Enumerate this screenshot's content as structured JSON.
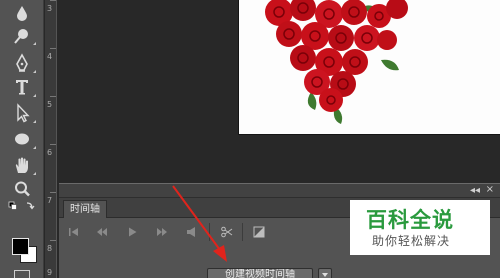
{
  "ruler": {
    "labels": [
      "3",
      "4",
      "5",
      "6",
      "7",
      "8",
      "9"
    ]
  },
  "timeline_panel": {
    "tab_label": "时间轴",
    "create_button_label": "创建视频时间轴",
    "collapse_symbol": "◂◂",
    "close_symbol": "×"
  },
  "toolbar": {
    "tools": [
      "blur-icon",
      "dodge-icon",
      "pen-icon",
      "type-icon",
      "path-selection-icon",
      "ellipse-icon",
      "hand-icon",
      "zoom-icon",
      "swap-colors-icon",
      "foreground-background-colors"
    ]
  },
  "watermark": {
    "title": "百科全说",
    "subtitle": "助你轻松解决"
  },
  "colors": {
    "watermark_green": "#2a9a3e",
    "arrow_red": "#e0241c",
    "rose_red": "#c8101a",
    "leaf_green": "#3f7a30"
  }
}
